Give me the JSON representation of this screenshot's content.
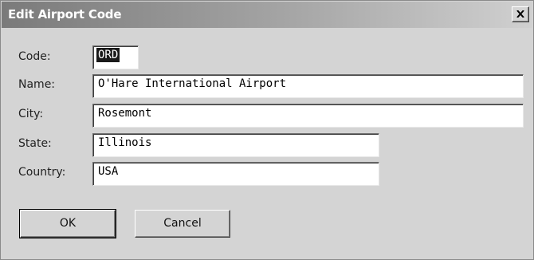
{
  "window": {
    "title": "Edit Airport Code"
  },
  "form": {
    "code": {
      "label": "Code:",
      "value": "ORD"
    },
    "name": {
      "label": "Name:",
      "value": "O'Hare International Airport"
    },
    "city": {
      "label": "City:",
      "value": "Rosemont"
    },
    "state": {
      "label": "State:",
      "value": "Illinois"
    },
    "country": {
      "label": "Country:",
      "value": "USA"
    }
  },
  "buttons": {
    "ok": "OK",
    "cancel": "Cancel"
  },
  "icons": {
    "close": "close-icon"
  }
}
